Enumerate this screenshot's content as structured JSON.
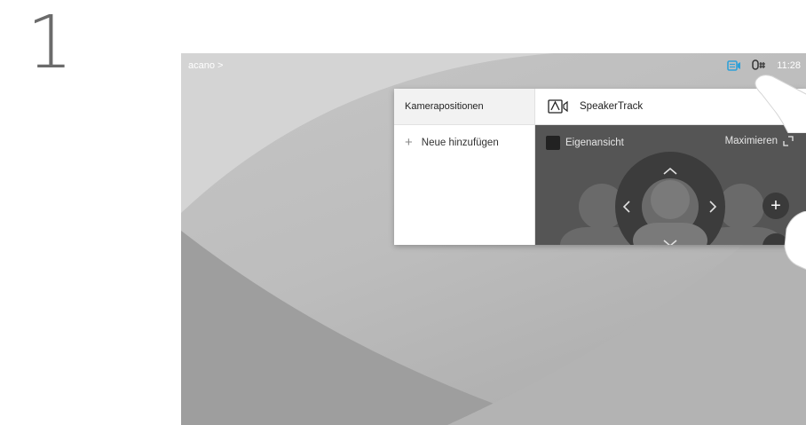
{
  "step": {
    "number": "1"
  },
  "screen": {
    "breadcrumb": "acano >",
    "status": {
      "time": "11:28",
      "icons": [
        "camera-panel-icon",
        "microphone-hash-icon"
      ]
    }
  },
  "panel": {
    "presets_title": "Kamerapositionen",
    "add_preset": {
      "icon": "+",
      "label": "Neue hinzufügen"
    },
    "speakertrack_label": "SpeakerTrack",
    "selfview_label": "Eigenansicht",
    "maximize_label": "Maximieren",
    "zoom_in": "+",
    "zoom_out": "–",
    "controls": {
      "up": "^",
      "down": "v",
      "left": "<",
      "right": ">"
    }
  },
  "colors": {
    "accent_blue": "#2ea0d8",
    "camera_bg": "#555555",
    "zoom_btn": "#3a3a3a"
  }
}
